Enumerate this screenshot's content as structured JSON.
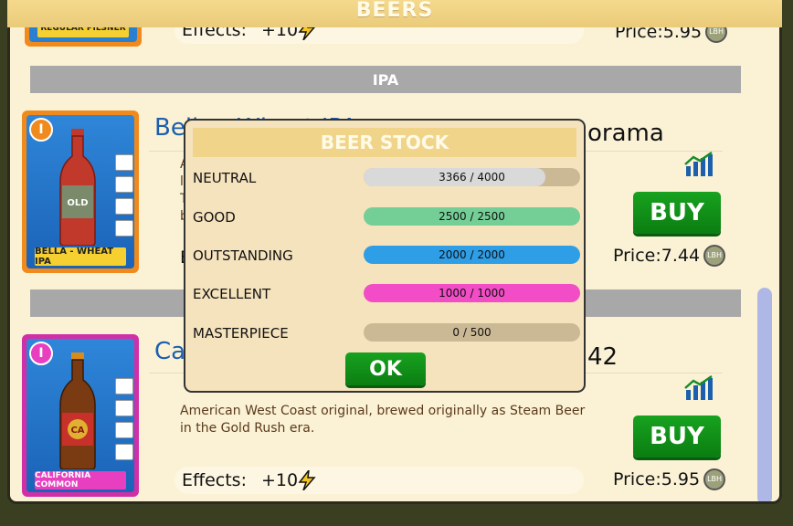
{
  "header": {
    "title": "BEERS"
  },
  "top_item": {
    "label": "REGULAR PILSNER",
    "effects_label": "Effects:",
    "effects_value": "+10",
    "price": "Price:5.95"
  },
  "sections": [
    {
      "label": "IPA"
    }
  ],
  "items": [
    {
      "card_label": "BELLA - WHEAT IPA",
      "badge": "I",
      "bottle_label": "OLD",
      "title_left": "Bella - Wheat IPA",
      "title_right": "orama",
      "desc_fragments": [
        "A",
        "li",
        "T",
        "b"
      ],
      "effects_prefix": "E",
      "buy_label": "BUY",
      "price": "Price:7.44"
    },
    {
      "card_label": "CALIFORNIA COMMON",
      "badge": "I",
      "bottle_label": "CA",
      "title_left": "Ca",
      "title_right": "42",
      "description_line1": "American West Coast original, brewed originally as Steam Beer",
      "description_line2": "in the Gold Rush era.",
      "effects_label": "Effects:",
      "effects_value": "+10",
      "buy_label": "BUY",
      "price": "Price:5.95"
    }
  ],
  "coin_text": "LBH",
  "icons": [
    "lightning-icon",
    "coin-icon",
    "stats-chart-icon",
    "percent-icon",
    "chart-icon",
    "ibu-icon",
    "lips-icon"
  ],
  "colors": {
    "buy_green": "#0b8f16",
    "title_blue": "#1c5fae",
    "section_gray": "#a8a8a8"
  },
  "beer_stock": {
    "title": "BEER STOCK",
    "rows": [
      {
        "label": "NEUTRAL",
        "text": "3366 / 4000",
        "current": 3366,
        "max": 4000,
        "color": "#d9d9d9"
      },
      {
        "label": "GOOD",
        "text": "2500 / 2500",
        "current": 2500,
        "max": 2500,
        "color": "#74cf97"
      },
      {
        "label": "OUTSTANDING",
        "text": "2000 / 2000",
        "current": 2000,
        "max": 2000,
        "color": "#2e9ee6"
      },
      {
        "label": "EXCELLENT",
        "text": "1000 / 1000",
        "current": 1000,
        "max": 1000,
        "color": "#f24cc6"
      },
      {
        "label": "MASTERPIECE",
        "text": "0 / 500",
        "current": 0,
        "max": 500,
        "color": "#cbb995"
      }
    ],
    "ok_label": "OK"
  }
}
